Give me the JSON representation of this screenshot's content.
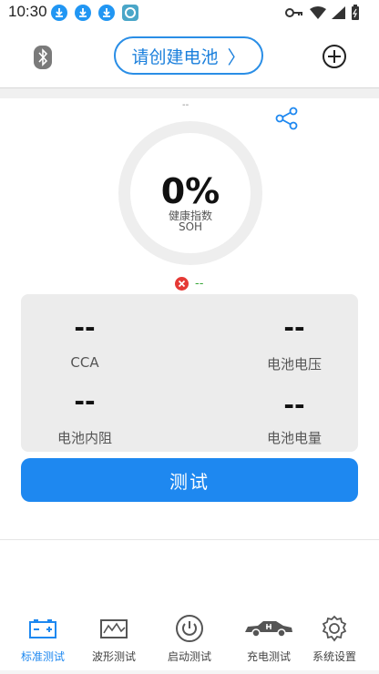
{
  "status_bar": {
    "time": "10:30"
  },
  "header": {
    "title": "请创建电池",
    "title_chevron": "〉"
  },
  "gauge": {
    "top_label": "--",
    "percent_text": "0%",
    "percent_value": 0,
    "label": "健康指数",
    "sublabel": "SOH"
  },
  "status": {
    "text": "--"
  },
  "metrics": [
    {
      "value": "--",
      "label": "CCA"
    },
    {
      "value": "--",
      "label": "电池电压"
    },
    {
      "value": "--",
      "label": "电池内阻"
    },
    {
      "value": "--",
      "label": "电池电量"
    }
  ],
  "test_button": {
    "label": "测试"
  },
  "nav": [
    {
      "label": "标准测试",
      "icon": "battery-icon",
      "active": true
    },
    {
      "label": "波形测试",
      "icon": "waveform-icon",
      "active": false
    },
    {
      "label": "启动测试",
      "icon": "power-icon",
      "active": false
    },
    {
      "label": "充电测试",
      "icon": "car-charging-icon",
      "active": false
    },
    {
      "label": "系统设置",
      "icon": "gear-icon",
      "active": false
    }
  ],
  "colors": {
    "accent": "#1e88f0",
    "error": "#e53935",
    "ok": "#3aa83a",
    "panel": "#ececec"
  }
}
